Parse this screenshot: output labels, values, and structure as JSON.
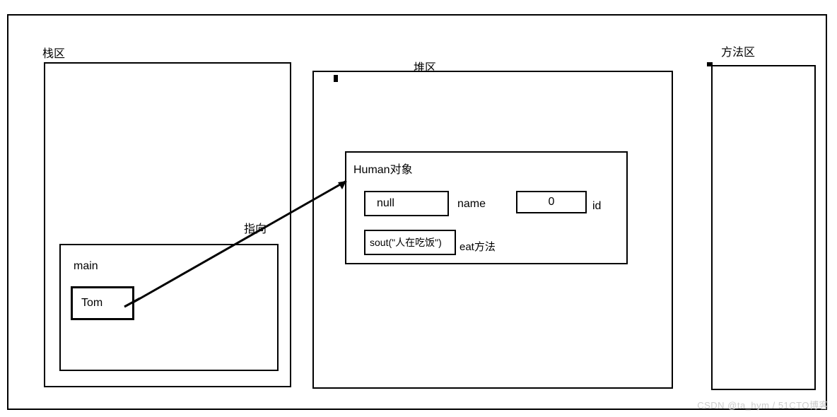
{
  "stack": {
    "title": "栈区",
    "main_label": "main",
    "var_value": "Tom"
  },
  "heap": {
    "title": "堆区",
    "object": {
      "title": "Human对象",
      "name_value": "null",
      "name_label": "name",
      "id_value": "0",
      "id_label": "id",
      "method_body": "sout(\"人在吃饭\")",
      "method_label": "eat方法"
    }
  },
  "method_area": {
    "title": "方法区"
  },
  "arrow_label": "指向",
  "watermark": "CSDN @ta_hym / 51CTO博客"
}
